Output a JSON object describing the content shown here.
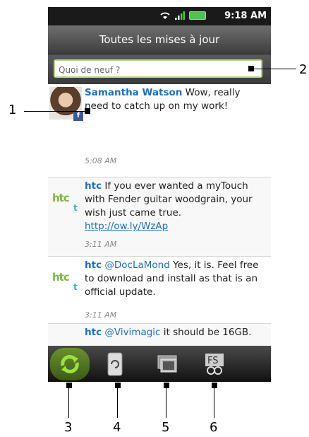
{
  "status": {
    "time": "9:18 AM"
  },
  "title": "Toutes les mises à jour",
  "compose": {
    "placeholder": "Quoi de neuf ?"
  },
  "posts": [
    {
      "name": "Samantha Watson",
      "text": " Wow, really need to catch up on my work!",
      "time": "5:08 AM"
    },
    {
      "name": "htc",
      "text": " If you ever wanted a myTouch with Fender guitar woodgrain, your wish just came true. ",
      "link": "http://ow.ly/WzAp",
      "time": "3:11 AM"
    },
    {
      "name": "htc",
      "mention": "@DocLaMond",
      "text": " Yes, it is. Feel free to download and install as that is an official update.",
      "time": "3:11 AM"
    },
    {
      "name": "htc",
      "mention": "@Vivimagic",
      "text": " it should be 16GB."
    }
  ],
  "logo_text": "htc",
  "callouts": [
    "1",
    "2",
    "3",
    "4",
    "5",
    "6"
  ],
  "colors": {
    "accent": "#7fb640",
    "link": "#1f6fb6",
    "facebook": "#3b5998",
    "twitter": "#33b3e0"
  },
  "icons": [
    "wifi-icon",
    "signal-icon",
    "battery-icon",
    "refresh-icon",
    "rotate-icon",
    "photos-icon",
    "friend-stream-icon",
    "facebook-badge-icon",
    "twitter-badge-icon"
  ]
}
